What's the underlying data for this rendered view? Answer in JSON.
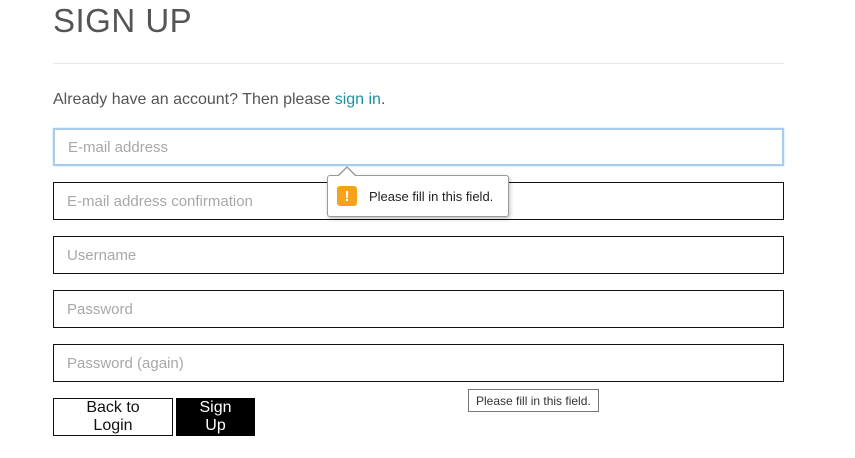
{
  "header": {
    "title": "SIGN UP"
  },
  "signin_prompt": {
    "text_before": "Already have an account? Then please ",
    "link_text": "sign in",
    "text_after": "."
  },
  "form": {
    "email_placeholder": "E-mail address",
    "email_confirm_placeholder": "E-mail address confirmation",
    "username_placeholder": "Username",
    "password_placeholder": "Password",
    "password_again_placeholder": "Password (again)"
  },
  "buttons": {
    "back_label": "Back to Login",
    "signup_label": "Sign Up"
  },
  "validation": {
    "bubble_icon_glyph": "!",
    "bubble_message": "Please fill in this field.",
    "tooltip_message": "Please fill in this field."
  },
  "colors": {
    "link": "#17949e",
    "warning_icon": "#f7a21b",
    "focus_border": "#a9cbec",
    "primary_button": "#000000"
  }
}
